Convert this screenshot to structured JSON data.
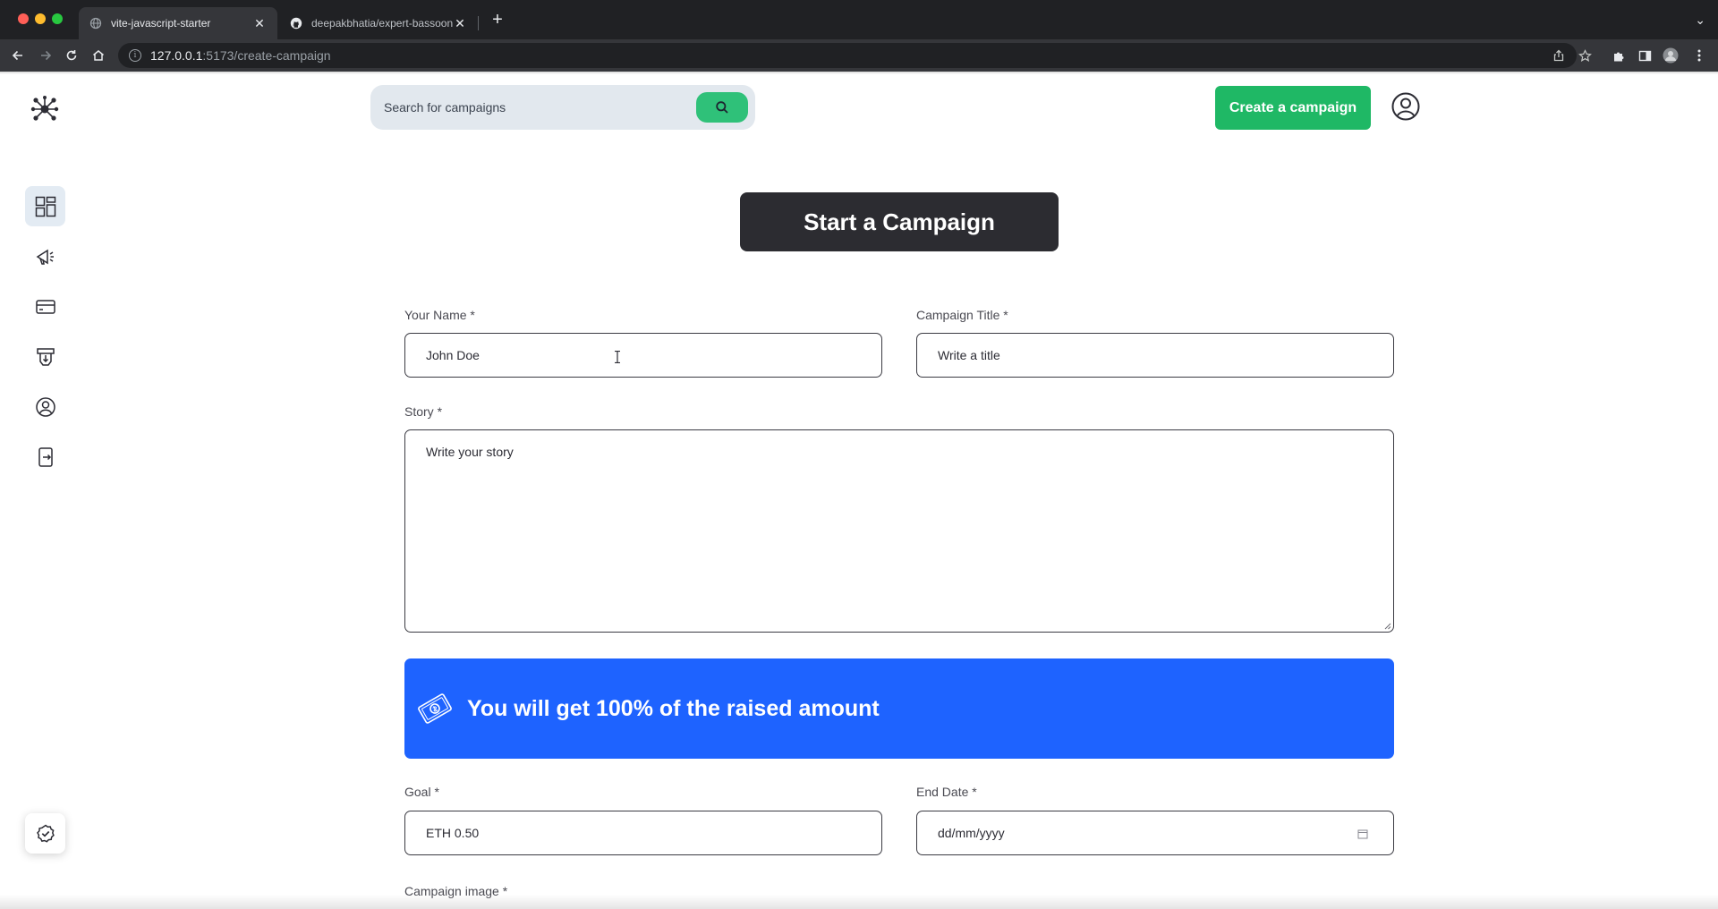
{
  "browser": {
    "tabs": [
      {
        "title": "vite-javascript-starter",
        "active": true,
        "icon": "globe-icon"
      },
      {
        "title": "deepakbhatia/expert-bassoon",
        "active": false,
        "icon": "github-icon"
      }
    ],
    "url_host": "127.0.0.1",
    "url_path": ":5173/create-campaign"
  },
  "header": {
    "search_placeholder": "Search for campaigns",
    "create_button": "Create a campaign"
  },
  "sidebar": {
    "items": [
      {
        "icon": "dashboard-icon",
        "active": true
      },
      {
        "icon": "megaphone-icon",
        "active": false
      },
      {
        "icon": "card-icon",
        "active": false
      },
      {
        "icon": "withdraw-icon",
        "active": false
      },
      {
        "icon": "profile-icon",
        "active": false
      },
      {
        "icon": "logout-icon",
        "active": false
      }
    ],
    "bottom_icon": "verified-check-icon"
  },
  "form": {
    "title": "Start a Campaign",
    "name_label": "Your Name *",
    "name_value": "John Doe",
    "title_label": "Campaign Title *",
    "title_placeholder": "Write a title",
    "story_label": "Story *",
    "story_placeholder": "Write your story",
    "banner_text": "You will get 100% of the raised amount",
    "goal_label": "Goal *",
    "goal_placeholder": "ETH 0.50",
    "end_date_label": "End Date *",
    "end_date_placeholder": "dd/mm/yyyy",
    "image_label": "Campaign image *"
  },
  "colors": {
    "accent_green": "#1fb865",
    "banner_blue": "#1e63ff",
    "title_bg": "#2c2c31"
  }
}
